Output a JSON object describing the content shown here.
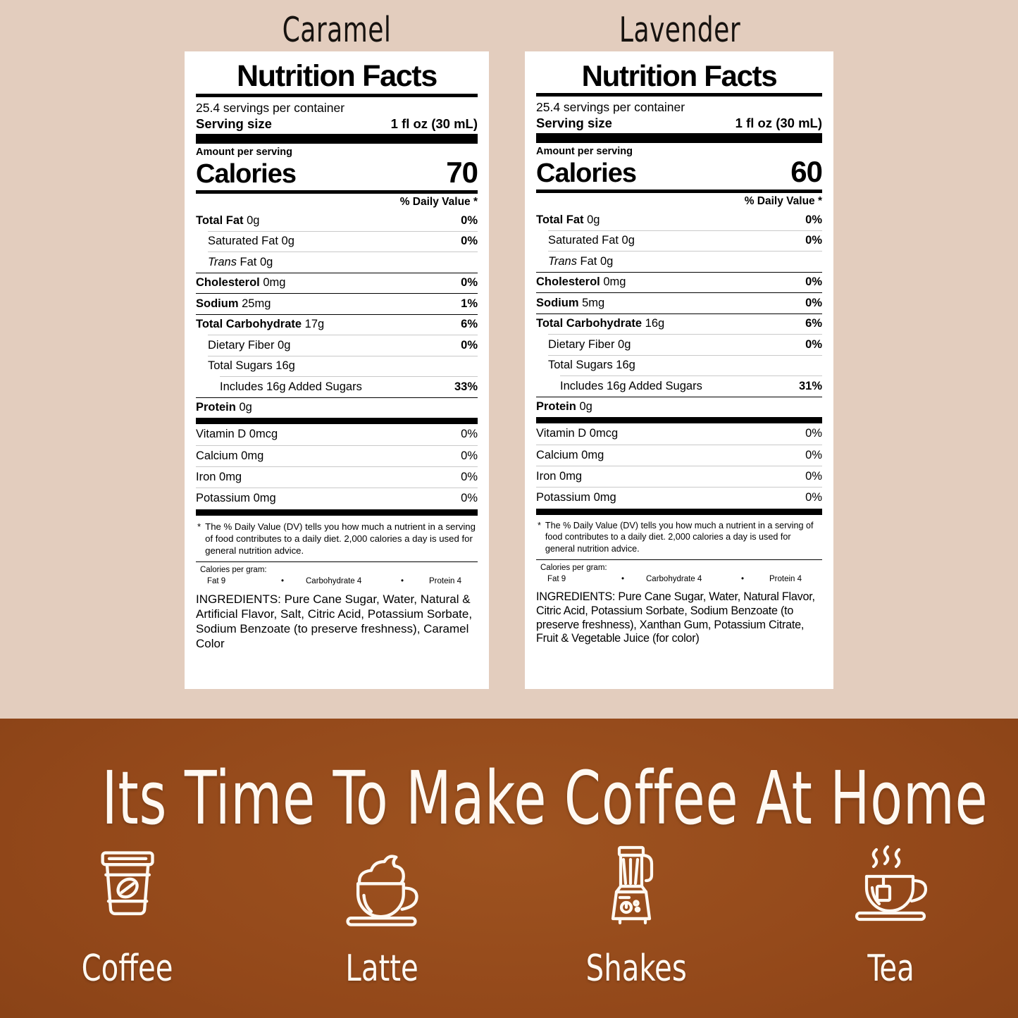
{
  "background": {
    "top_color": "#E3CDBE",
    "banner_color": "#93481A"
  },
  "panels": [
    {
      "flavor_title": "Caramel",
      "title": "Nutrition Facts",
      "servings_per_container": "25.4 servings per container",
      "serving_size_label": "Serving size",
      "serving_size_value": "1 fl oz (30 mL)",
      "amount_per_serving": "Amount per serving",
      "calories_label": "Calories",
      "calories_value": "70",
      "daily_value_header": "% Daily Value *",
      "nutrients": [
        {
          "name": "Total Fat",
          "bold": true,
          "amount": "0g",
          "dv": "0%",
          "indent": 0
        },
        {
          "name": "Saturated Fat",
          "bold": false,
          "amount": "0g",
          "dv": "0%",
          "indent": 1
        },
        {
          "name": "Trans",
          "italic": true,
          "suffix": "Fat 0g",
          "amount": "",
          "dv": "",
          "indent": 1
        },
        {
          "name": "Cholesterol",
          "bold": true,
          "amount": "0mg",
          "dv": "0%",
          "indent": 0
        },
        {
          "name": "Sodium",
          "bold": true,
          "amount": "25mg",
          "dv": "1%",
          "indent": 0
        },
        {
          "name": "Total Carbohydrate",
          "bold": true,
          "amount": "17g",
          "dv": "6%",
          "indent": 0
        },
        {
          "name": "Dietary Fiber",
          "bold": false,
          "amount": "0g",
          "dv": "0%",
          "indent": 1
        },
        {
          "name": "Total Sugars",
          "bold": false,
          "amount": "16g",
          "dv": "",
          "indent": 1
        },
        {
          "name": "Includes 16g Added Sugars",
          "bold": false,
          "amount": "",
          "dv": "33%",
          "indent": 2
        },
        {
          "name": "Protein",
          "bold": true,
          "amount": "0g",
          "dv": "",
          "indent": 0
        }
      ],
      "vitamins": [
        {
          "name": "Vitamin D 0mcg",
          "dv": "0%"
        },
        {
          "name": "Calcium 0mg",
          "dv": "0%"
        },
        {
          "name": "Iron 0mg",
          "dv": "0%"
        },
        {
          "name": "Potassium 0mg",
          "dv": "0%"
        }
      ],
      "footnote_star": "*",
      "footnote": "The % Daily Value (DV) tells you how much a nutrient in a serving of food contributes to a daily diet. 2,000 calories a day is used for general nutrition advice.",
      "calories_per_gram_label": "Calories per gram:",
      "calories_per_gram": {
        "fat": "Fat 9",
        "dot1": "•",
        "carb": "Carbohydrate 4",
        "dot2": "•",
        "protein": "Protein 4"
      },
      "ingredients": "INGREDIENTS: Pure Cane Sugar, Water, Natural & Artificial Flavor, Salt, Citric Acid, Potassium Sorbate, Sodium Benzoate (to preserve freshness), Caramel Color"
    },
    {
      "flavor_title": "Lavender",
      "title": "Nutrition Facts",
      "servings_per_container": "25.4 servings per container",
      "serving_size_label": "Serving size",
      "serving_size_value": "1 fl oz (30 mL)",
      "amount_per_serving": "Amount per serving",
      "calories_label": "Calories",
      "calories_value": "60",
      "daily_value_header": "% Daily Value *",
      "nutrients": [
        {
          "name": "Total Fat",
          "bold": true,
          "amount": "0g",
          "dv": "0%",
          "indent": 0
        },
        {
          "name": "Saturated Fat",
          "bold": false,
          "amount": "0g",
          "dv": "0%",
          "indent": 1
        },
        {
          "name": "Trans",
          "italic": true,
          "suffix": "Fat 0g",
          "amount": "",
          "dv": "",
          "indent": 1
        },
        {
          "name": "Cholesterol",
          "bold": true,
          "amount": "0mg",
          "dv": "0%",
          "indent": 0
        },
        {
          "name": "Sodium",
          "bold": true,
          "amount": "5mg",
          "dv": "0%",
          "indent": 0
        },
        {
          "name": "Total Carbohydrate",
          "bold": true,
          "amount": "16g",
          "dv": "6%",
          "indent": 0
        },
        {
          "name": "Dietary Fiber",
          "bold": false,
          "amount": "0g",
          "dv": "0%",
          "indent": 1
        },
        {
          "name": "Total Sugars",
          "bold": false,
          "amount": "16g",
          "dv": "",
          "indent": 1
        },
        {
          "name": "Includes 16g Added Sugars",
          "bold": false,
          "amount": "",
          "dv": "31%",
          "indent": 2
        },
        {
          "name": "Protein",
          "bold": true,
          "amount": "0g",
          "dv": "",
          "indent": 0
        }
      ],
      "vitamins": [
        {
          "name": "Vitamin D 0mcg",
          "dv": "0%"
        },
        {
          "name": "Calcium 0mg",
          "dv": "0%"
        },
        {
          "name": "Iron 0mg",
          "dv": "0%"
        },
        {
          "name": "Potassium 0mg",
          "dv": "0%"
        }
      ],
      "footnote_star": "*",
      "footnote": "The % Daily Value (DV) tells you how much a nutrient in a serving of food contributes to a daily diet. 2,000 calories a day is used for general nutrition advice.",
      "calories_per_gram_label": "Calories per gram:",
      "calories_per_gram": {
        "fat": "Fat 9",
        "dot1": "•",
        "carb": "Carbohydrate 4",
        "dot2": "•",
        "protein": "Protein 4"
      },
      "ingredients": "INGREDIENTS: Pure Cane Sugar, Water, Natural Flavor, Citric Acid, Potassium Sorbate, Sodium Benzoate (to preserve freshness), Xanthan Gum, Potassium Citrate, Fruit & Vegetable Juice (for color)"
    }
  ],
  "banner": {
    "heading": "Its Time To Make Coffee At Home",
    "items": [
      {
        "icon": "coffee-cup-icon",
        "label": "Coffee"
      },
      {
        "icon": "latte-cup-icon",
        "label": "Latte"
      },
      {
        "icon": "blender-icon",
        "label": "Shakes"
      },
      {
        "icon": "tea-cup-icon",
        "label": "Tea"
      }
    ]
  }
}
